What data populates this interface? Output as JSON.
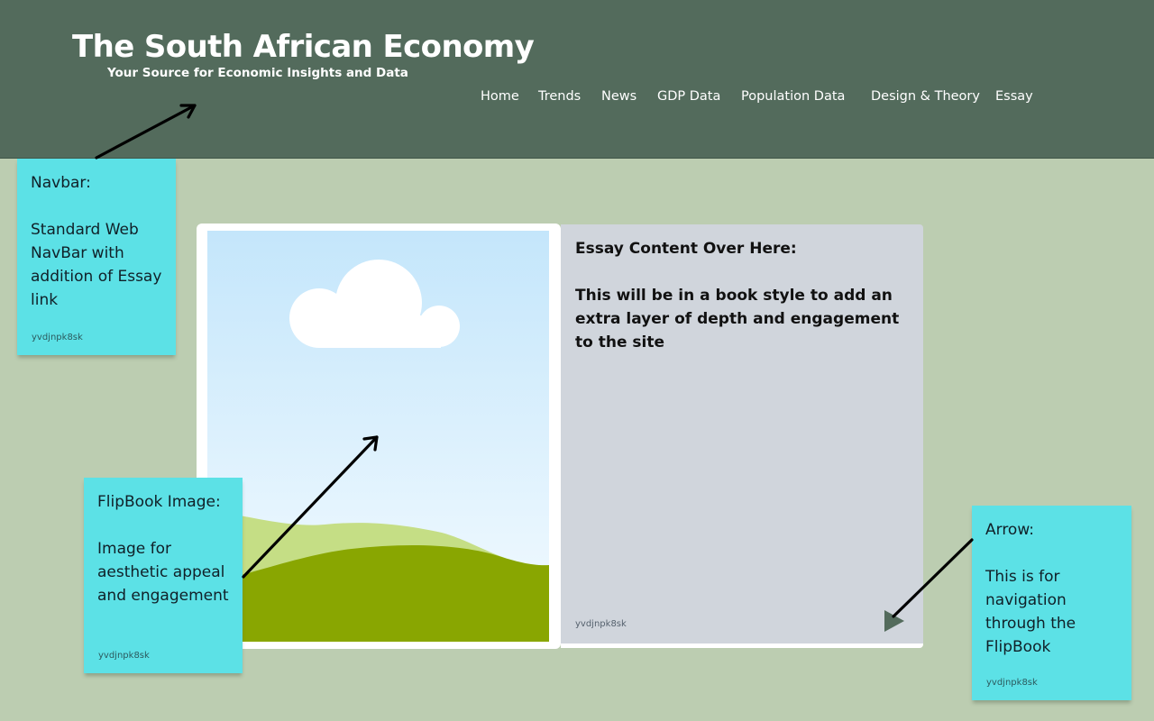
{
  "header": {
    "title": "The South African Economy",
    "subtitle": "Your Source for Economic Insights and Data"
  },
  "nav": [
    "Home",
    "Trends",
    "News",
    "GDP Data",
    "Population Data",
    "Design & Theory",
    "Essay"
  ],
  "book": {
    "image_icon": "flipbook-landscape-image",
    "essay_heading": "Essay Content Over Here:",
    "essay_body": "This will be in a book style to add an extra layer of depth and engagement to the site",
    "watermark": "yvdjnpk8sk",
    "next_icon": "play-arrow-icon"
  },
  "notes": {
    "navbar": {
      "text": "Navbar:\n\nStandard Web NavBar with addition of Essay link",
      "watermark": "yvdjnpk8sk"
    },
    "flipbook": {
      "text": "FlipBook Image:\n\nImage for aesthetic appeal and engagement",
      "watermark": "yvdjnpk8sk"
    },
    "arrow": {
      "text": "Arrow:\n\nThis is for navigation through the FlipBook",
      "watermark": "yvdjnpk8sk"
    }
  },
  "colors": {
    "header_bg": "#536b5c",
    "page_bg": "#bccdb1",
    "note_bg": "#5ce1e6",
    "book_page_bg": "#d0d5dc",
    "arrow_button": "#536b5c"
  }
}
